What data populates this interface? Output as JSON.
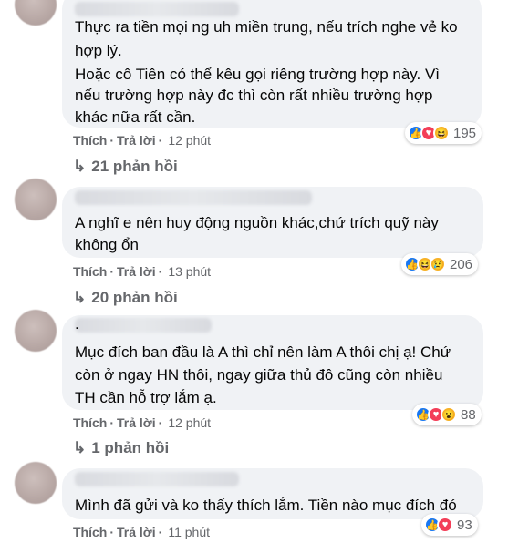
{
  "comments": [
    {
      "lines": [
        "Thực ra tiền mọi ng uh miền trung, nếu trích nghe vẻ ko",
        "hợp lý.",
        "Hoặc cô Tiên có thể kêu gọi riêng trường hợp này. Vì",
        "nếu trường hợp này đc thì còn rất nhiều trường hợp",
        "khác nữa rất cần."
      ],
      "like": "Thích",
      "reply": "Trả lời",
      "time": "12 phút",
      "reaction_icons": [
        "like-icon",
        "love-icon",
        "haha-icon"
      ],
      "reaction_count": "195",
      "replies": "21 phản hồi"
    },
    {
      "lines": [
        "A nghĩ e nên huy động nguồn khác,chứ trích quỹ này",
        "không ổn"
      ],
      "like": "Thích",
      "reply": "Trả lời",
      "time": "13 phút",
      "reaction_icons": [
        "like-icon",
        "haha-icon",
        "sad-icon"
      ],
      "reaction_count": "206",
      "replies": "20 phản hồi"
    },
    {
      "dot": ".",
      "lines": [
        "Mục đích ban đầu là A thì chỉ nên làm A thôi chị ạ! Chứ",
        "còn ở ngay HN thôi, ngay giữa thủ đô cũng còn nhiều",
        "TH cần hỗ trợ lắm ạ."
      ],
      "like": "Thích",
      "reply": "Trả lời",
      "time": "12 phút",
      "reaction_icons": [
        "like-icon",
        "love-icon",
        "wow-icon"
      ],
      "reaction_count": "88",
      "replies": "1 phản hồi"
    },
    {
      "lines": [
        "Mình đã gửi và ko thấy thích lắm. Tiền nào mục đích đó"
      ],
      "like": "Thích",
      "reply": "Trả lời",
      "time": "11 phút",
      "reaction_icons": [
        "like-icon",
        "love-icon"
      ],
      "reaction_count": "93"
    }
  ],
  "colors": {
    "bubble": "#f0f2f5",
    "meta": "#65676b",
    "like": "#1877f2",
    "love": "#f33e58",
    "haha": "#f7b125"
  }
}
